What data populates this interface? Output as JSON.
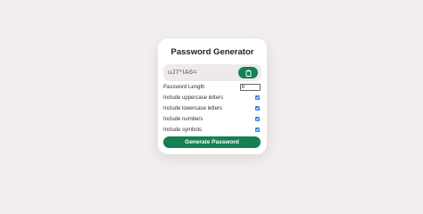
{
  "generator": {
    "title": "Password Generator",
    "password_value": "uJ7*IA6=",
    "copy_icon": "clipboard-icon",
    "length_label": "Password Length",
    "length_value": "8",
    "options": [
      {
        "label": "Include uppercase letters",
        "checked": true
      },
      {
        "label": "Include lowercase letters",
        "checked": true
      },
      {
        "label": "Include numbers",
        "checked": true
      },
      {
        "label": "Include symbols",
        "checked": true
      }
    ],
    "generate_label": "Generate Password"
  },
  "colors": {
    "background": "#f2eeee",
    "accent": "#148054",
    "checkbox": "#2f7fe0"
  }
}
